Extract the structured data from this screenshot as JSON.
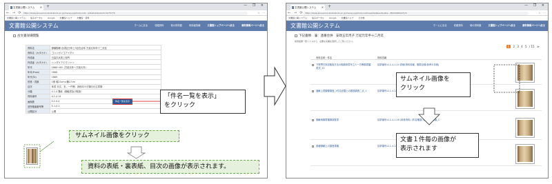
{
  "browser": {
    "tab_title": "文書館公開システム",
    "new_tab": "+",
    "window_controls": "— ❐ ✕",
    "nav_buttons": "← → ⟳ ⌂",
    "url_left": "https://www.kousei.tunakatoikodo.ac.jp/mensyu/jp/tools/ndl/.../pRa6n0/bookid=1075775",
    "url_right": "https://www.kousei.tunakatoikodo.ac.jp/mensyu/jp/tools/ndl/view/listResultsdata.../B0U00B002574",
    "url_icons": "☆ ⋯",
    "bookmarks": [
      "文書館公開システム",
      "電子ポータル",
      "Google",
      "文書館ヘルプ",
      "文書館・資料",
      "その他"
    ]
  },
  "site": {
    "title": "文書館公開システム",
    "nav": [
      "ホームに戻る",
      "収蔵資料",
      "他の資料館",
      "利用者情報"
    ],
    "nav_bold": [
      "文書館トップページへ戻る",
      "資料情報ページへ戻る"
    ]
  },
  "left": {
    "heading": "古文書詳細閲覧",
    "rows": [
      {
        "k": "資料名",
        "v": "御願御様 合成区分年上5百石合年 万延元年申十二月迄"
      },
      {
        "k": "資料名（カタカナ）",
        "v": "ゴハンガンゴアイダメ"
      },
      {
        "k": "作成者",
        "v": "日高平兵衛上松吟"
      },
      {
        "k": "作成者（カタカナ）",
        "v": "ハンダケアエモリャン"
      },
      {
        "k": "年代",
        "v": "1860〜69（万延元年〜万延元年）"
      },
      {
        "k": "年月(From)",
        "v": "1860"
      },
      {
        "k": "年代(To)",
        "v": "1869"
      },
      {
        "k": "形態・員数",
        "v": "1冊  縦23cm×横17cm"
      },
      {
        "k": "目次",
        "v": "序書 天文、玄、一円等、其他月十日御日仕立書御"
      },
      {
        "k": "分類",
        "v": "4.1.4  藩政（御触書及び取扱）"
      },
      {
        "k": "資料番号",
        "v": "A.1.4.14"
      },
      {
        "k": "画像数",
        "v": "E.1.0.4"
      },
      {
        "k": "旧所蔵者番号等",
        "v": "E-1-0-2"
      },
      {
        "k": "公開区分",
        "v": "公開"
      }
    ],
    "show_button": "件名一覧を表示"
  },
  "right": {
    "heading": "下記書類　藩：連番合併　安政五年丙子 万延元年申十二月迄",
    "note": "検索結果一覧リストから、必要な文書を選択してご覧ください。",
    "pager": {
      "current": "1",
      "pages": [
        "1",
        "2",
        "3",
        "4",
        "5",
        "/ 15",
        "≫"
      ]
    },
    "col_headers": [
      "資料名称・件名",
      "資料情報"
    ],
    "rows": [
      {
        "title": "下院寄付本記取扱方法の御調申書写之人一方等御書類　書式_15",
        "info": "請求番号:A-1-4-1-14 詳細:資料情報、御書目録(参考の手続)"
      },
      {
        "title": "諸献上書類御調査_2件名記載上の数図調査二点_1",
        "info": "請求番号:A-1-4-1-15 詳細:資料情報(二件)"
      },
      {
        "title": "御献納御書類御調查書",
        "info": "請求番号:A-1-4-1-16 (持参資料) (件名確認) 御計画訴訟者_1"
      },
      {
        "title": "各種御献上の調査書類",
        "info": "請求番号:A-1-4-1-17 詳細:資料情報(参考)"
      }
    ]
  },
  "callouts": {
    "show_list": "「件名一覧を表示」\nをクリック",
    "thumb_click_left": "サムネイル画像をクリック",
    "cover_images": "資料の表紙・裏表紙、目次の画像が表示されます。",
    "thumb_click_right": "サムネイル画像を\nクリック",
    "single_image": "文書１件毎の画像が\n表示されます"
  }
}
